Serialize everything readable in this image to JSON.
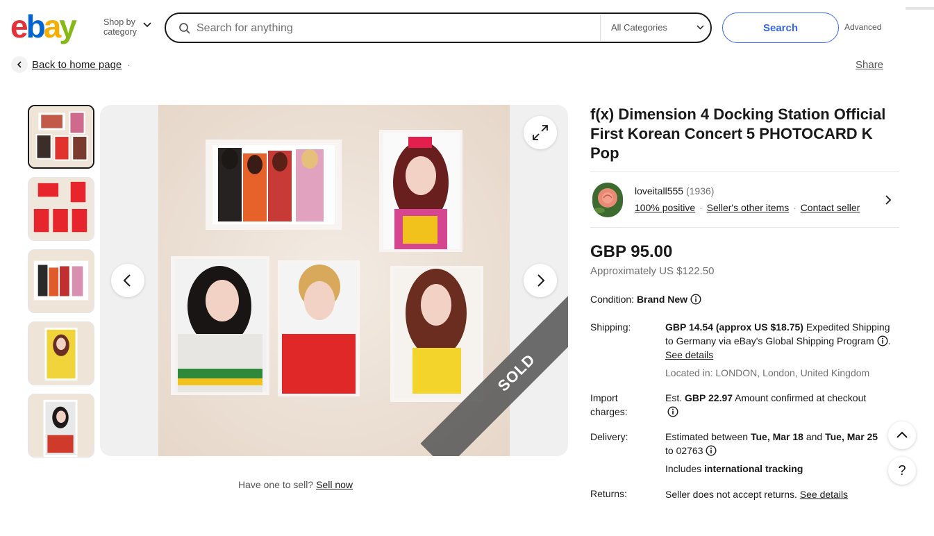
{
  "header": {
    "logo": {
      "e": "e",
      "b": "b",
      "a": "a",
      "y": "y"
    },
    "shop_by_line1": "Shop by",
    "shop_by_line2": "category",
    "search_placeholder": "Search for anything",
    "category_select": "All Categories",
    "search_button": "Search",
    "advanced_link": "Advanced"
  },
  "nav": {
    "back_link": "Back to home page",
    "back_dot": "·",
    "share_link": "Share"
  },
  "gallery": {
    "thumbnail_count": 5,
    "selected_index": 0,
    "sold_label": "SOLD"
  },
  "sell_prompt": {
    "text": "Have one to sell?",
    "link": "Sell now"
  },
  "listing": {
    "title": "f(x) Dimension 4 Docking Station Official First Korean Concert 5 PHOTOCARD K Pop",
    "seller": {
      "name": "loveitall555",
      "feedback_count": "(1936)",
      "positive": "100% positive",
      "other_items": "Seller's other items",
      "contact": "Contact seller",
      "sep": "·"
    },
    "price": "GBP 95.00",
    "approx_price": "Approximately US $122.50",
    "condition": {
      "label": "Condition:",
      "value": "Brand New"
    },
    "shipping": {
      "label": "Shipping:",
      "amount": "GBP 14.54 (approx US $18.75)",
      "method": "Expedited Shipping to Germany via eBay's Global Shipping Program",
      "dot": ".",
      "details_link": "See details",
      "located_label": "Located in:",
      "located_value": "LONDON, London, United Kingdom"
    },
    "import": {
      "label_line1": "Import",
      "label_line2": "charges:",
      "est": "Est.",
      "amount": "GBP 22.97",
      "note": "Amount confirmed at checkout"
    },
    "delivery": {
      "label": "Delivery:",
      "prefix": "Estimated between",
      "date1": "Tue, Mar 18",
      "and": "and",
      "date2": "Tue, Mar 25",
      "to": "to 02763",
      "tracking_prefix": "Includes",
      "tracking": "international tracking"
    },
    "returns": {
      "label": "Returns:",
      "value": "Seller does not accept returns.",
      "details_link": "See details"
    }
  },
  "floating": {
    "help": "?"
  }
}
